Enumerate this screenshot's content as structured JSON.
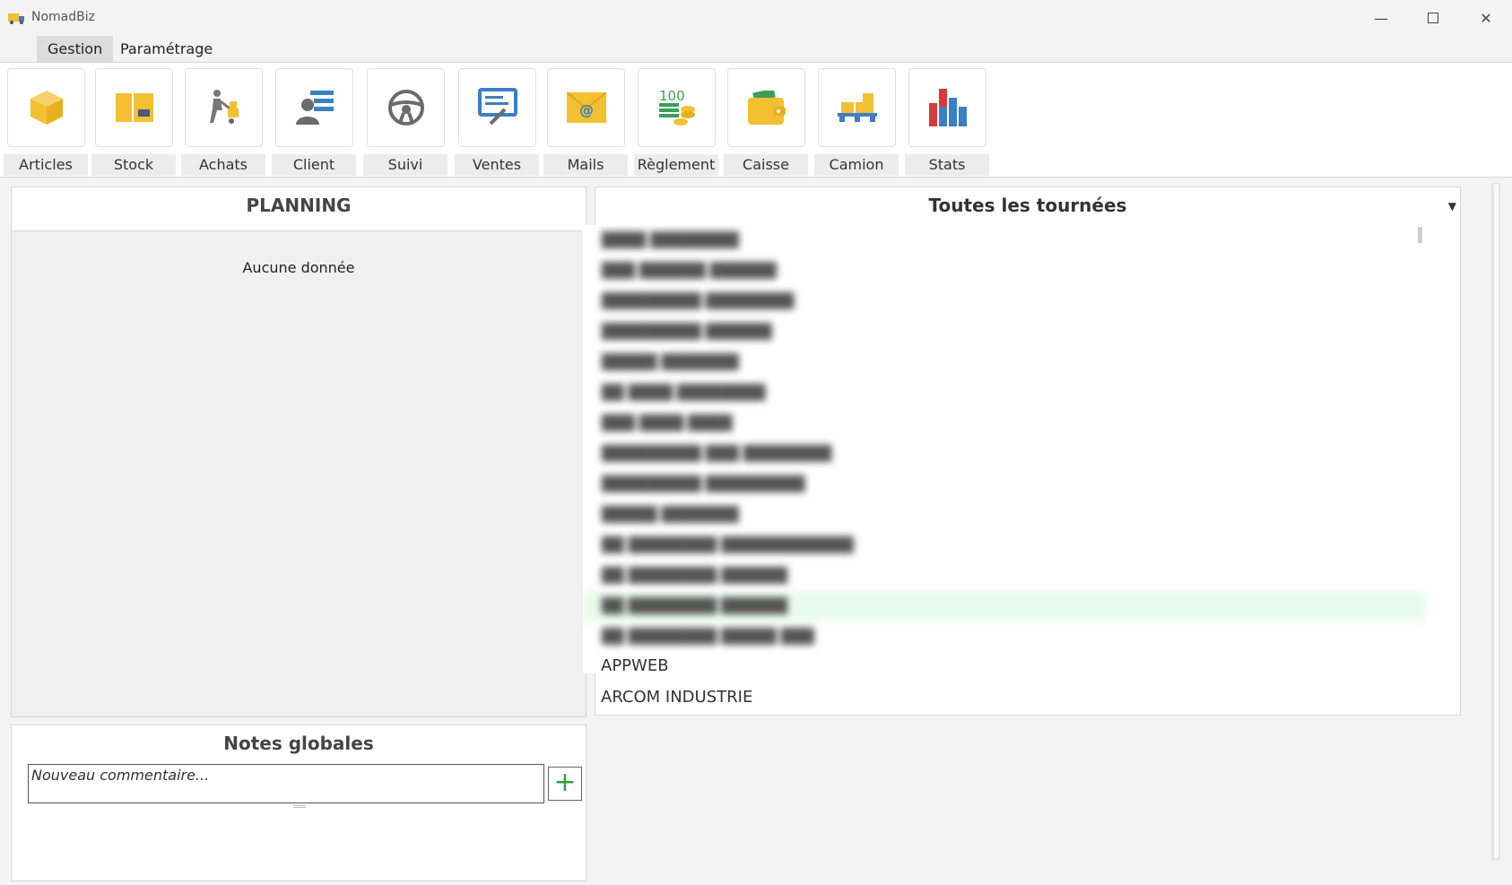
{
  "window": {
    "title": "NomadBiz"
  },
  "menu": {
    "gestion": "Gestion",
    "parametrage": "Paramétrage"
  },
  "ribbon": {
    "tools": [
      {
        "label": "Articles",
        "icon": "box-icon"
      },
      {
        "label": "Stock",
        "icon": "stock-icon"
      },
      {
        "label": "Achats",
        "icon": "hand-truck-icon"
      },
      {
        "label": "Client",
        "icon": "client-card-icon"
      },
      {
        "label": "Suivi",
        "icon": "steering-wheel-icon"
      },
      {
        "label": "Ventes",
        "icon": "sales-sign-icon"
      },
      {
        "label": "Mails",
        "icon": "mail-icon"
      },
      {
        "label": "Règlement",
        "icon": "money-coins-icon"
      },
      {
        "label": "Caisse",
        "icon": "wallet-icon"
      },
      {
        "label": "Camion",
        "icon": "pallet-truck-icon"
      },
      {
        "label": "Stats",
        "icon": "bar-chart-icon"
      }
    ]
  },
  "planning": {
    "title": "PLANNING",
    "empty_text": "Aucune donnée"
  },
  "notes": {
    "title": "Notes globales",
    "placeholder": "Nouveau commentaire...",
    "add_symbol": "+"
  },
  "tournees": {
    "selected": "Toutes les tournées",
    "visible_items": [
      "APPWEB",
      "ARCOM INDUSTRIE"
    ]
  },
  "colors": {
    "accent_yellow": "#f2c032",
    "icon_blue": "#3b7fc4",
    "icon_gray": "#6b6b6b",
    "add_green": "#2e9e3e",
    "selection_green": "#e9fbec"
  }
}
